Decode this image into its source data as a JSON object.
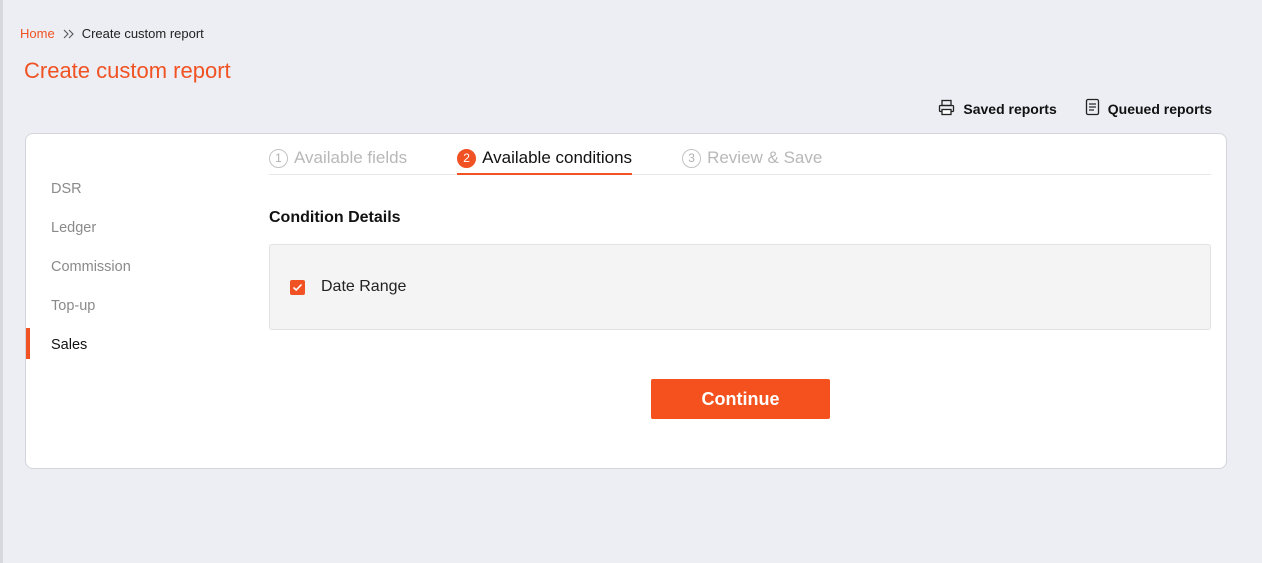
{
  "breadcrumb": {
    "home": "Home",
    "current": "Create custom report"
  },
  "page": {
    "title": "Create custom report"
  },
  "toolbar": {
    "saved_reports": "Saved reports",
    "queued_reports": "Queued reports"
  },
  "sidebar": {
    "items": [
      {
        "label": "DSR",
        "active": false
      },
      {
        "label": "Ledger",
        "active": false
      },
      {
        "label": "Commission",
        "active": false
      },
      {
        "label": "Top-up",
        "active": false
      },
      {
        "label": "Sales",
        "active": true
      }
    ]
  },
  "steps": [
    {
      "number": "1",
      "label": "Available fields",
      "active": false
    },
    {
      "number": "2",
      "label": "Available conditions",
      "active": true
    },
    {
      "number": "3",
      "label": "Review & Save",
      "active": false
    }
  ],
  "conditions": {
    "title": "Condition Details",
    "items": [
      {
        "label": "Date Range",
        "checked": true
      }
    ]
  },
  "actions": {
    "continue_label": "Continue"
  },
  "colors": {
    "accent": "#f05223",
    "background": "#eceef3"
  },
  "icons": {
    "breadcrumb_separator": "double-chevron-right-icon",
    "saved_reports": "printer-icon",
    "queued_reports": "document-icon",
    "checkbox": "checkmark-icon"
  }
}
